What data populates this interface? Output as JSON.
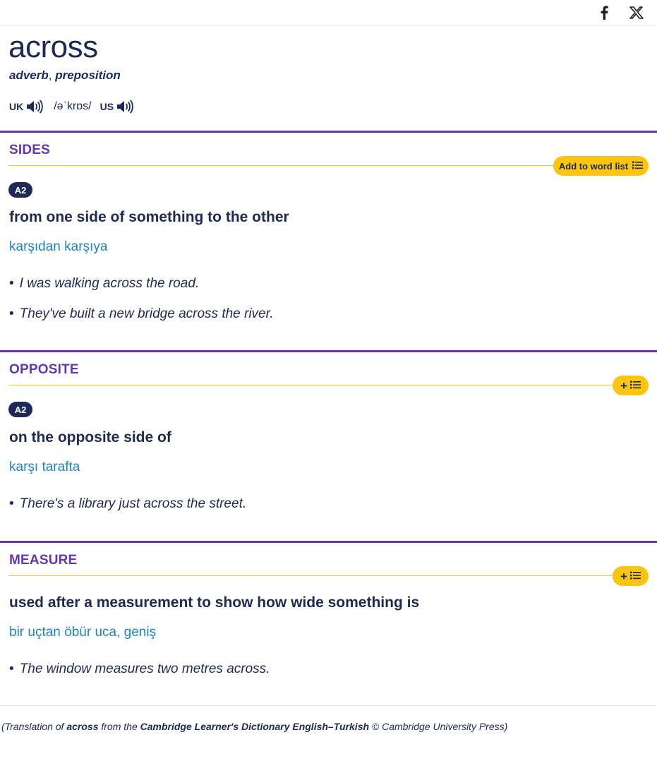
{
  "share": {
    "facebook_icon": "facebook-icon",
    "x_icon": "x-icon"
  },
  "entry": {
    "headword": "across",
    "pos1": "adverb",
    "pos_sep": ",",
    "pos2": "preposition",
    "uk_label": "UK",
    "ipa": "/əˈkrɒs/",
    "us_label": "US"
  },
  "senses": [
    {
      "guideword": "SIDES",
      "add_label": "Add to word list",
      "level": "A2",
      "definition": "from one side of something to the other",
      "translation": "karşıdan karşıya",
      "examples": [
        "I was walking across the road.",
        "They've built a new bridge across the river."
      ]
    },
    {
      "guideword": "OPPOSITE",
      "add_label": "+",
      "level": "A2",
      "definition": "on the opposite side of",
      "translation": "karşı tarafta",
      "examples": [
        "There's a library just across the street."
      ]
    },
    {
      "guideword": "MEASURE",
      "add_label": "+",
      "definition": "used after a measurement to show how wide something is",
      "translation": "bir uçtan öbür uca, geniş",
      "examples": [
        "The window measures two metres across."
      ]
    }
  ],
  "footer": {
    "pre": "(Translation of ",
    "word": "across",
    "mid": " from the ",
    "dictionary": "Cambridge Learner's Dictionary English–Turkish",
    "post": " © Cambridge University Press)"
  },
  "colors": {
    "accent": "#6236b4",
    "navy": "#1d2a57",
    "translation": "#1a84c7",
    "button": "#fbc40d"
  }
}
